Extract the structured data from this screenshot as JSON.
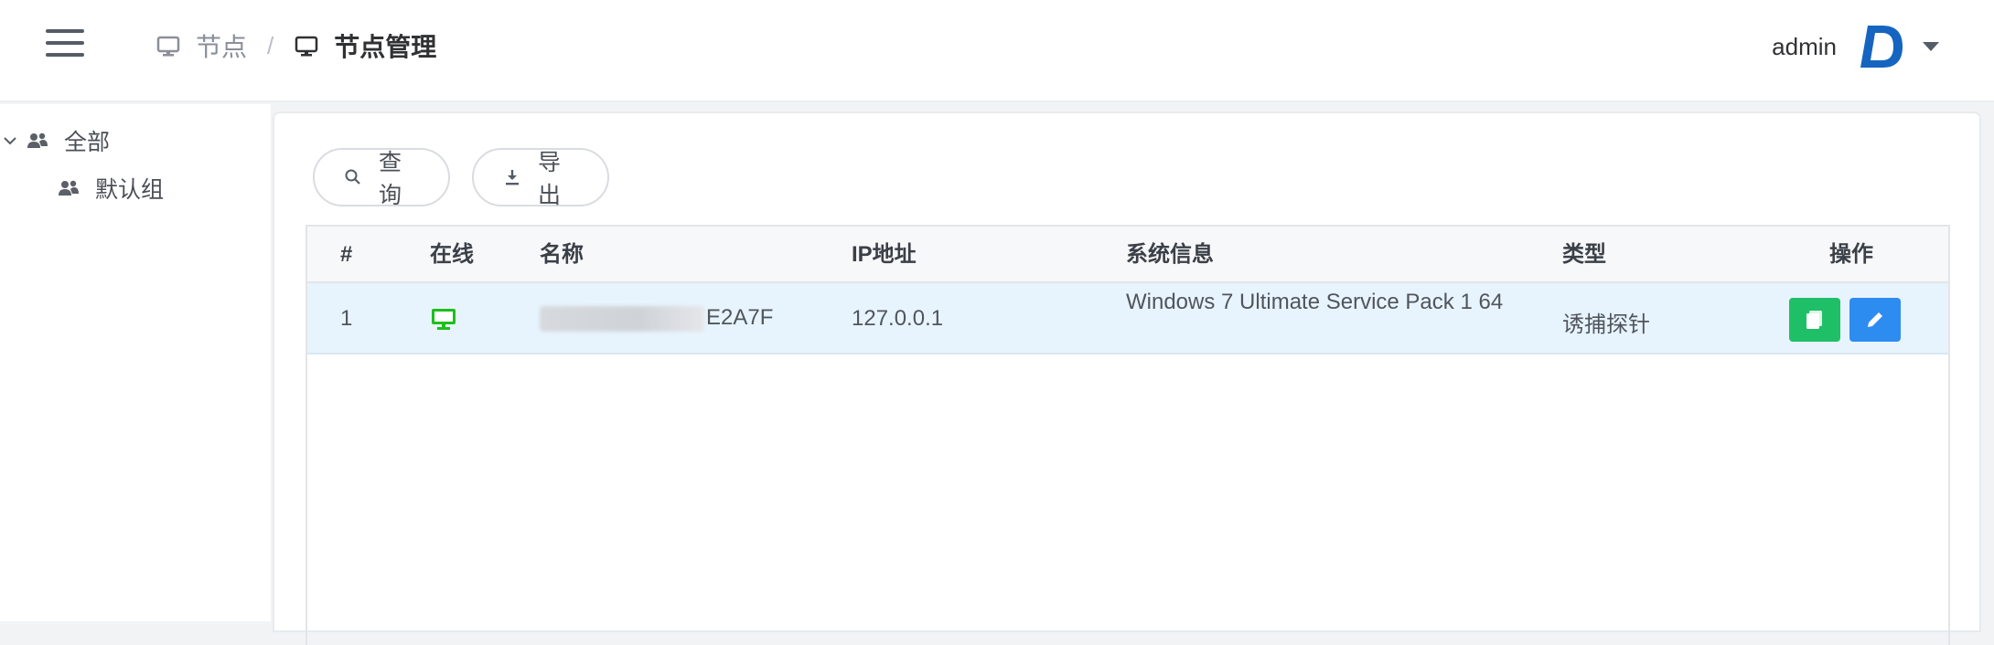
{
  "header": {
    "breadcrumb": [
      {
        "label": "节点",
        "icon": "monitor-icon"
      },
      {
        "label": "节点管理",
        "icon": "monitor-icon"
      }
    ],
    "separator": "/",
    "user": {
      "name": "admin",
      "avatar_icon": "d-logo-avatar"
    }
  },
  "sidebar": {
    "tree": [
      {
        "label": "全部",
        "icon": "group-icon",
        "expanded": true
      },
      {
        "label": "默认组",
        "icon": "group-icon"
      }
    ]
  },
  "toolbar": {
    "query_label": "查询",
    "export_label": "导出"
  },
  "table": {
    "columns": [
      "#",
      "在线",
      "名称",
      "IP地址",
      "系统信息",
      "类型",
      "操作"
    ],
    "rows": [
      {
        "index": "1",
        "online": true,
        "name_suffix": "E2A7F",
        "ip": "127.0.0.1",
        "sysinfo": "Windows 7 Ultimate Service Pack 1 64",
        "type": "诱捕探针"
      }
    ]
  },
  "colors": {
    "online": "#1dbf1d",
    "view_button": "#1fbf68",
    "edit_button": "#2d8cf0",
    "avatar": "#1565c0"
  }
}
